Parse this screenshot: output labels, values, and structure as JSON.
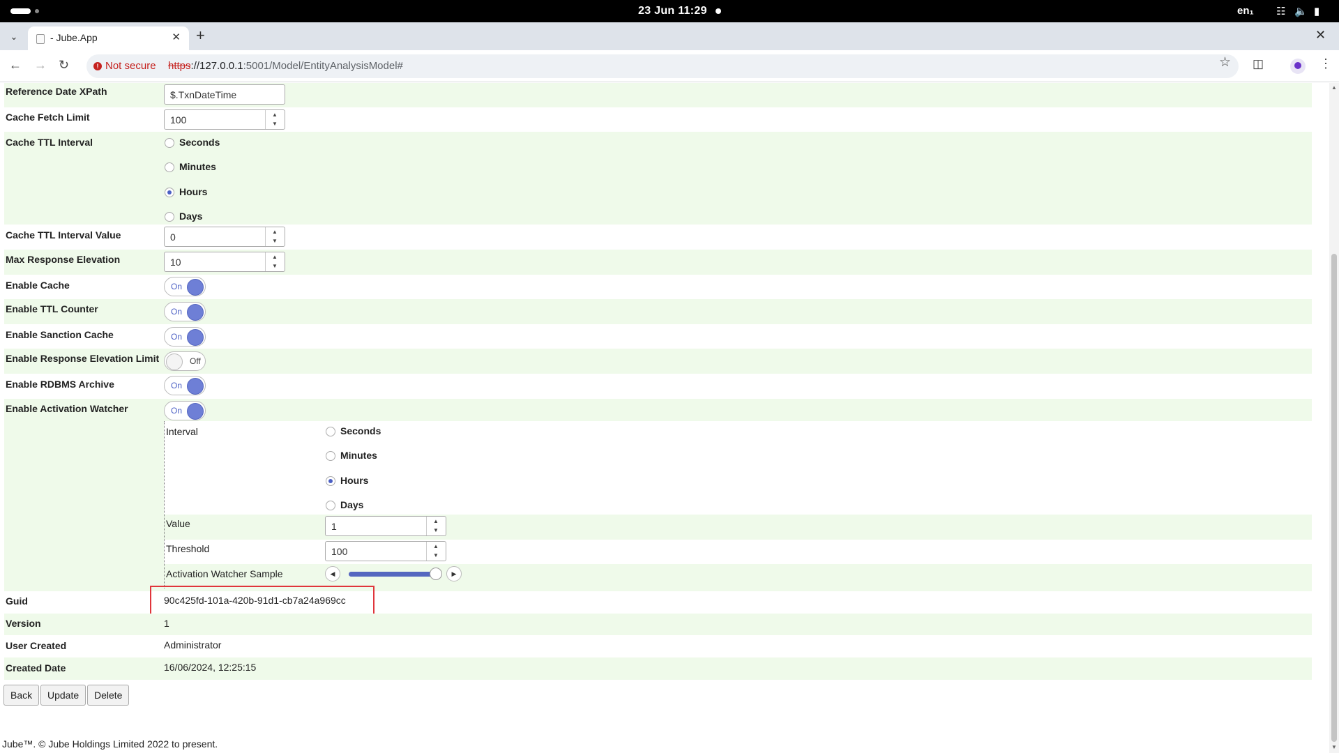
{
  "system": {
    "clock": "23 Jun  11:29",
    "lang": "en₁"
  },
  "browser": {
    "tab_title": "- Jube.App",
    "not_secure": "Not secure",
    "url_scheme": "https",
    "url_host": "://127.0.0.1",
    "url_path": ":5001/Model/EntityAnalysisModel#"
  },
  "form": {
    "reference_date_xpath": {
      "label": "Reference Date XPath",
      "value": "$.TxnDateTime"
    },
    "cache_fetch_limit": {
      "label": "Cache Fetch Limit",
      "value": "100"
    },
    "cache_ttl_interval": {
      "label": "Cache TTL Interval",
      "options": [
        "Seconds",
        "Minutes",
        "Hours",
        "Days"
      ],
      "selected": "Hours"
    },
    "cache_ttl_interval_value": {
      "label": "Cache TTL Interval Value",
      "value": "0"
    },
    "max_response_elevation": {
      "label": "Max Response Elevation",
      "value": "10"
    },
    "enable_cache": {
      "label": "Enable Cache",
      "state": "On"
    },
    "enable_ttl_counter": {
      "label": "Enable TTL Counter",
      "state": "On"
    },
    "enable_sanction_cache": {
      "label": "Enable Sanction Cache",
      "state": "On"
    },
    "enable_response_elevation_limit": {
      "label": "Enable Response Elevation Limit",
      "state": "Off"
    },
    "enable_rdbms_archive": {
      "label": "Enable RDBMS Archive",
      "state": "On"
    },
    "enable_activation_watcher": {
      "label": "Enable Activation Watcher",
      "state": "On"
    },
    "activation_watcher": {
      "interval_label": "Interval",
      "interval_options": [
        "Seconds",
        "Minutes",
        "Hours",
        "Days"
      ],
      "interval_selected": "Hours",
      "value_label": "Value",
      "value": "1",
      "threshold_label": "Threshold",
      "threshold": "100",
      "sample_label": "Activation Watcher Sample",
      "sample_fraction": 0.96
    },
    "guid": {
      "label": "Guid",
      "value": "90c425fd-101a-420b-91d1-cb7a24a969cc"
    },
    "version": {
      "label": "Version",
      "value": "1"
    },
    "user_created": {
      "label": "User Created",
      "value": "Administrator"
    },
    "created_date": {
      "label": "Created Date",
      "value": "16/06/2024, 12:25:15"
    }
  },
  "buttons": {
    "back": "Back",
    "update": "Update",
    "delete": "Delete"
  },
  "footer": "Jube™. © Jube Holdings Limited 2022 to present."
}
